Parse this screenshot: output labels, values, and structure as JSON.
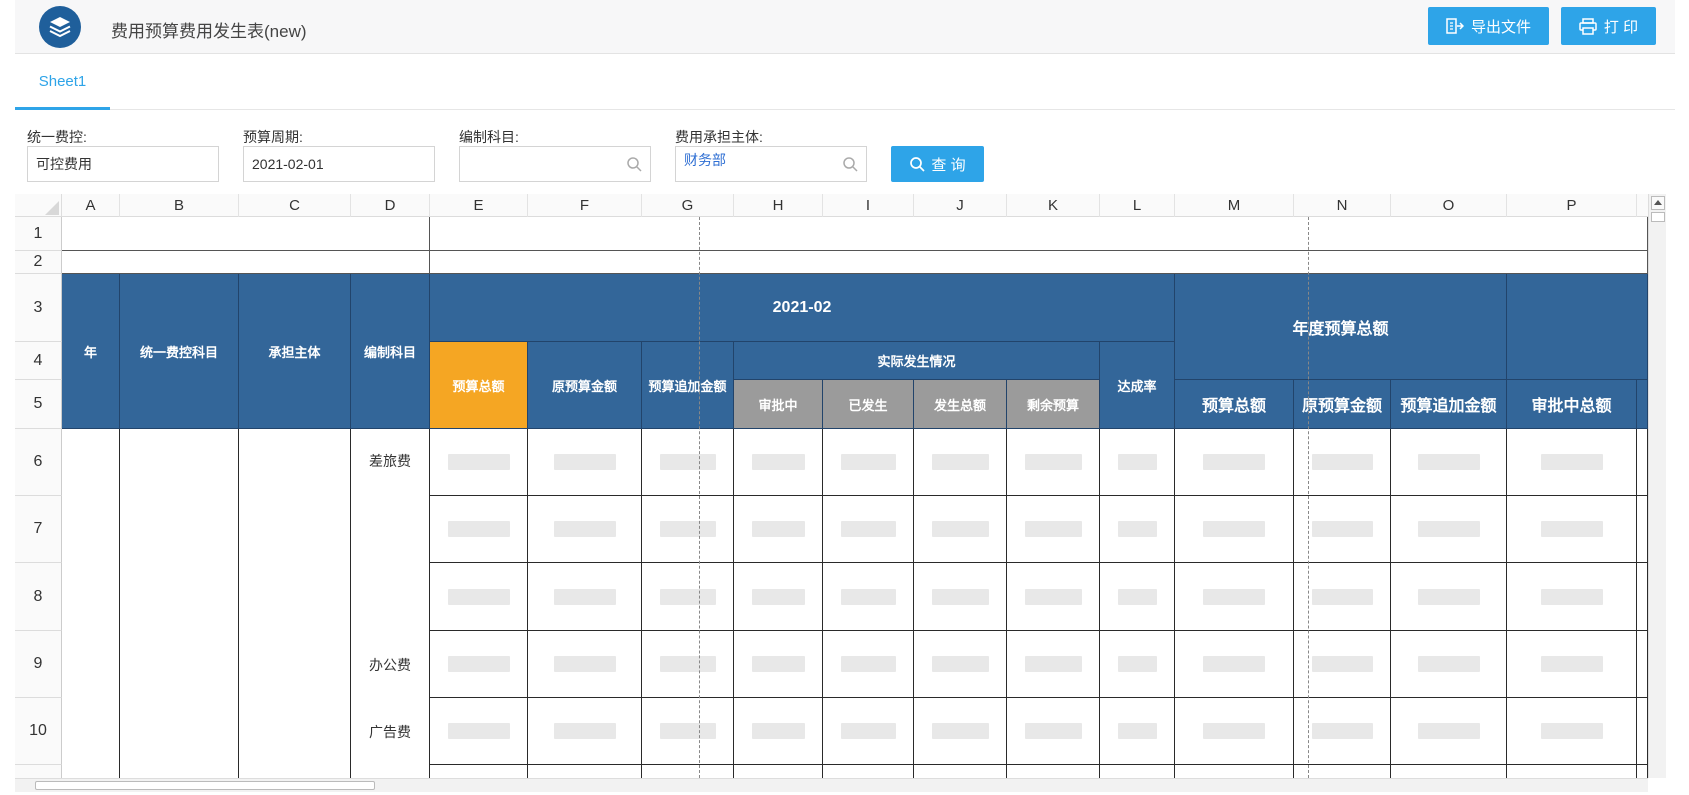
{
  "header": {
    "title": "费用预算费用发生表(new)",
    "export_label": "导出文件",
    "print_label": "打 印"
  },
  "tabs": [
    {
      "label": "Sheet1",
      "active": true
    }
  ],
  "filters": {
    "control": {
      "label": "统一费控:",
      "value": "可控费用"
    },
    "period": {
      "label": "预算周期:",
      "value": "2021-02-01"
    },
    "subject": {
      "label": "编制科目:",
      "value": ""
    },
    "entity": {
      "label": "费用承担主体:",
      "value": "财务部"
    },
    "query_label": "查 询"
  },
  "sheet": {
    "columns": [
      "A",
      "B",
      "C",
      "D",
      "E",
      "F",
      "G",
      "H",
      "I",
      "J",
      "K",
      "L",
      "M",
      "N",
      "O",
      "P"
    ],
    "rows": [
      "1",
      "2",
      "3",
      "4",
      "5",
      "6",
      "7",
      "8",
      "9",
      "10"
    ],
    "headers": {
      "year": "年",
      "control_subject": "统一费控科目",
      "entity": "承担主体",
      "subject": "编制科目",
      "period": "2021-02",
      "budget_total": "预算总额",
      "orig_budget": "原预算金额",
      "add_budget": "预算追加金额",
      "actual": "实际发生情况",
      "approving": "审批中",
      "occurred": "已发生",
      "occur_total": "发生总额",
      "remaining": "剩余预算",
      "rate": "达成率",
      "annual_total": "年度预算总额",
      "annual_budget_total": "预算总额",
      "annual_orig": "原预算金额",
      "annual_add": "预算追加金额",
      "annual_approving_total": "审批中总额"
    },
    "row_labels": {
      "r6": "差旅费",
      "r9": "办公费",
      "r10": "广告费"
    }
  },
  "colors": {
    "accent": "#2ea4e8",
    "header_blue": "#336699",
    "header_orange": "#f5a623",
    "header_gray": "#9b9b9b"
  }
}
